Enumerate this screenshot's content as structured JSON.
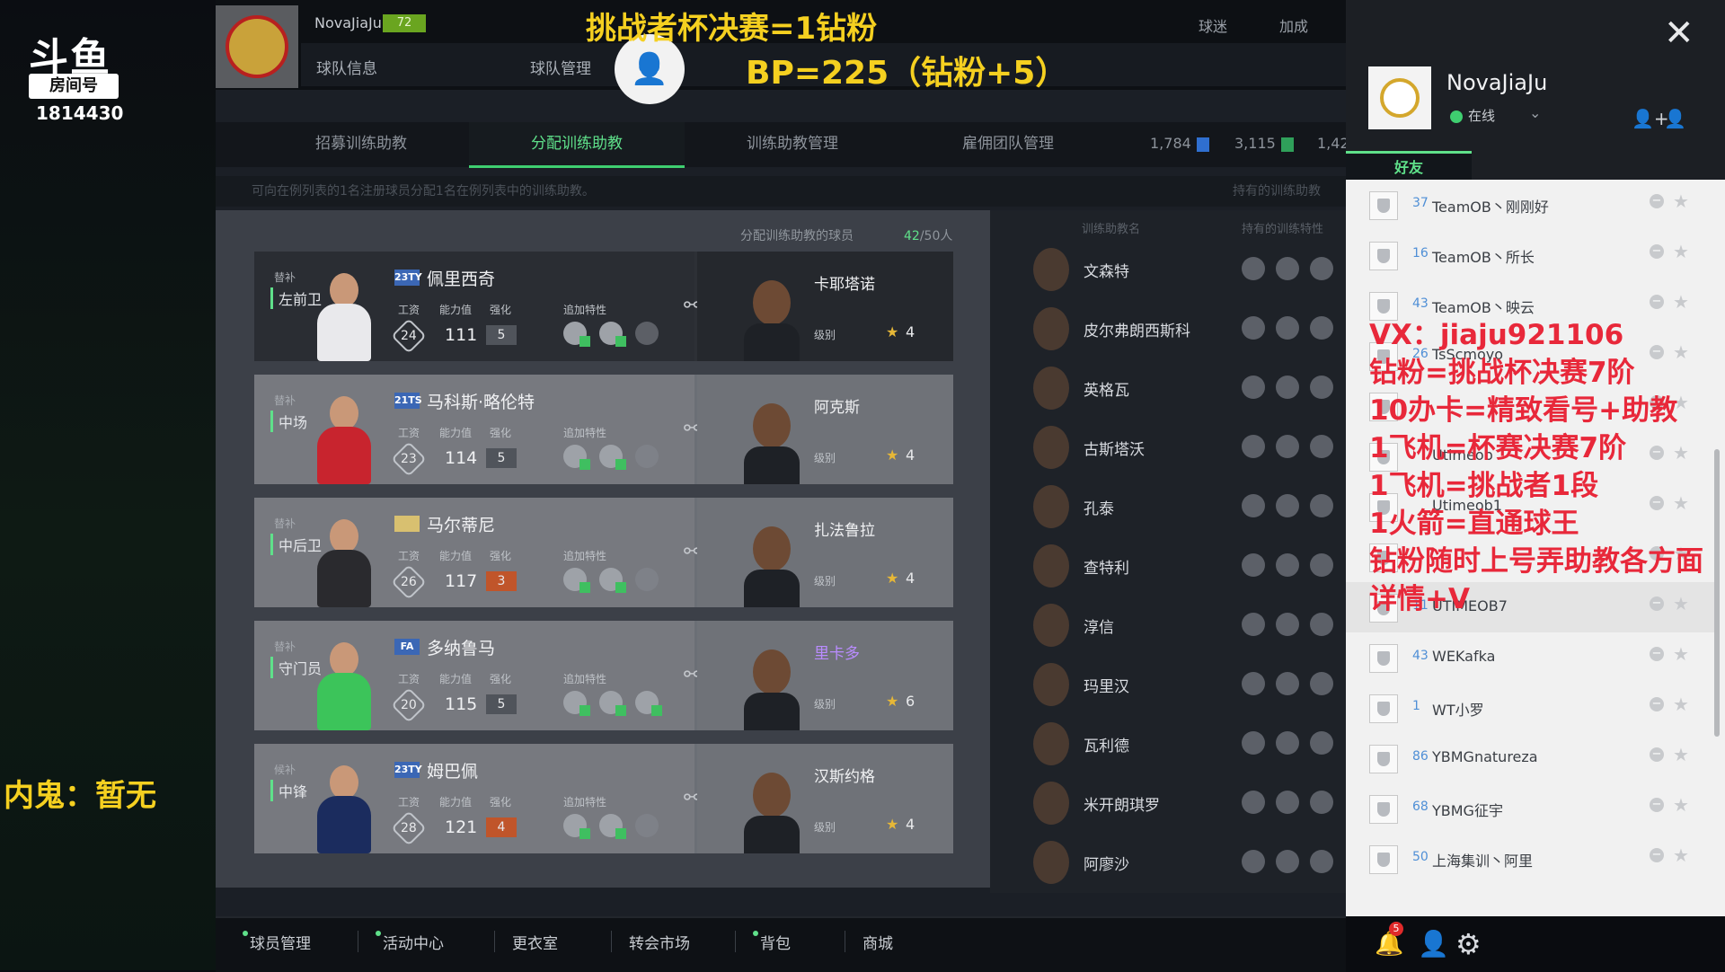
{
  "stream": {
    "logo": "斗鱼",
    "room_label": "房间号",
    "room_number": "1814430",
    "mole_text": "内鬼：暂无",
    "overlay_title": "挑战者杯决赛=1钻粉",
    "overlay_bp": "BP=225（钻粉+5）",
    "promo_lines": [
      "VX：jiaju921106",
      "钻粉=挑战杯决赛7阶",
      "10办卡=精致看号+助教",
      "1飞机=杯赛决赛7阶",
      "1飞机=挑战者1段",
      "1火箭=直通球王",
      "钻粉随时上号弄助教各方面",
      "详情+V"
    ]
  },
  "header": {
    "player_name": "NovaJiaJu",
    "level": "72",
    "links": [
      "球队信息",
      "球队管理"
    ],
    "right_links": [
      "球迷",
      "加成"
    ]
  },
  "tabs": [
    "招募训练助教",
    "分配训练助教",
    "训练助教管理",
    "雇佣团队管理"
  ],
  "active_tab_index": 1,
  "stats": [
    "1,784",
    "3,115",
    "1,42"
  ],
  "hint_left": "可向在例列表的1名注册球员分配1名在例列表中的训练助教。",
  "hint_right": "持有的训练助教",
  "panel": {
    "header_label": "分配训练助教的球员",
    "count_current": "42",
    "count_total": "/50人",
    "col_wage": "工资",
    "col_ovr": "能力值",
    "col_enh": "强化",
    "col_traits": "追加特性",
    "col_level": "级别",
    "rows": [
      {
        "slot": "替补",
        "position": "左前卫",
        "badge": "23TY",
        "name": "佩里西奇",
        "wage": "24",
        "ovr": "111",
        "enh": "5",
        "coach": "卡耶塔诺",
        "stars": "4",
        "dark": true,
        "kit": "#e9e9ec"
      },
      {
        "slot": "替补",
        "position": "中场",
        "badge": "21TS",
        "name": "马科斯·略伦特",
        "wage": "23",
        "ovr": "114",
        "enh": "5",
        "coach": "阿克斯",
        "stars": "4",
        "dark": false,
        "kit": "#c8242e"
      },
      {
        "slot": "替补",
        "position": "中后卫",
        "badge": "",
        "name": "马尔蒂尼",
        "wage": "26",
        "ovr": "117",
        "enh": "3",
        "coach": "扎法鲁拉",
        "stars": "4",
        "dark": false,
        "kit": "#2a2a2e"
      },
      {
        "slot": "替补",
        "position": "守门员",
        "badge": "FA",
        "name": "多纳鲁马",
        "wage": "20",
        "ovr": "115",
        "enh": "5",
        "coach": "里卡多",
        "stars": "6",
        "dark": false,
        "kit": "#3cc45a"
      },
      {
        "slot": "候补",
        "position": "中锋",
        "badge": "23TY",
        "name": "姆巴佩",
        "wage": "28",
        "ovr": "121",
        "enh": "4",
        "coach": "汉斯约格",
        "stars": "4",
        "dark": false,
        "kit": "#1b2c5e"
      }
    ]
  },
  "coach_list": {
    "col_name": "训练助教名",
    "col_traits": "持有的训练特性",
    "items": [
      "文森特",
      "皮尔弗朗西斯科",
      "英格瓦",
      "古斯塔沃",
      "孔泰",
      "查特利",
      "淳信",
      "玛里汉",
      "瓦利德",
      "米开朗琪罗",
      "阿廖沙"
    ]
  },
  "bottom_nav": [
    {
      "label": "球员管理",
      "dot": true
    },
    {
      "label": "活动中心",
      "dot": true
    },
    {
      "label": "更衣室",
      "dot": false
    },
    {
      "label": "转会市场",
      "dot": false
    },
    {
      "label": "背包",
      "dot": true
    },
    {
      "label": "商城",
      "dot": false
    }
  ],
  "notification_count": "5",
  "friends_panel": {
    "name": "NovaJiaJu",
    "status": "在线",
    "tab": "好友",
    "friends": [
      {
        "level": "37",
        "name": "TeamOB丶刚刚好"
      },
      {
        "level": "16",
        "name": "TeamOB丶所长"
      },
      {
        "level": "43",
        "name": "TeamOB丶映云"
      },
      {
        "level": "26",
        "name": "TsScmoyo"
      },
      {
        "level": "",
        "name": ""
      },
      {
        "level": "",
        "name": "Utimeob"
      },
      {
        "level": "",
        "name": "Utimeob1"
      },
      {
        "level": "",
        "name": ""
      },
      {
        "level": "11",
        "name": "UTIMEOB7"
      },
      {
        "level": "43",
        "name": "WEKafka"
      },
      {
        "level": "1",
        "name": "WT小罗"
      },
      {
        "level": "86",
        "name": "YBMGnatureza"
      },
      {
        "level": "68",
        "name": "YBMG征宇"
      },
      {
        "level": "50",
        "name": "上海集训丶阿里"
      }
    ]
  },
  "colors": {
    "accent_green": "#5fe08a",
    "overlay_yellow": "#f5d020",
    "promo_red": "#e8283a"
  }
}
